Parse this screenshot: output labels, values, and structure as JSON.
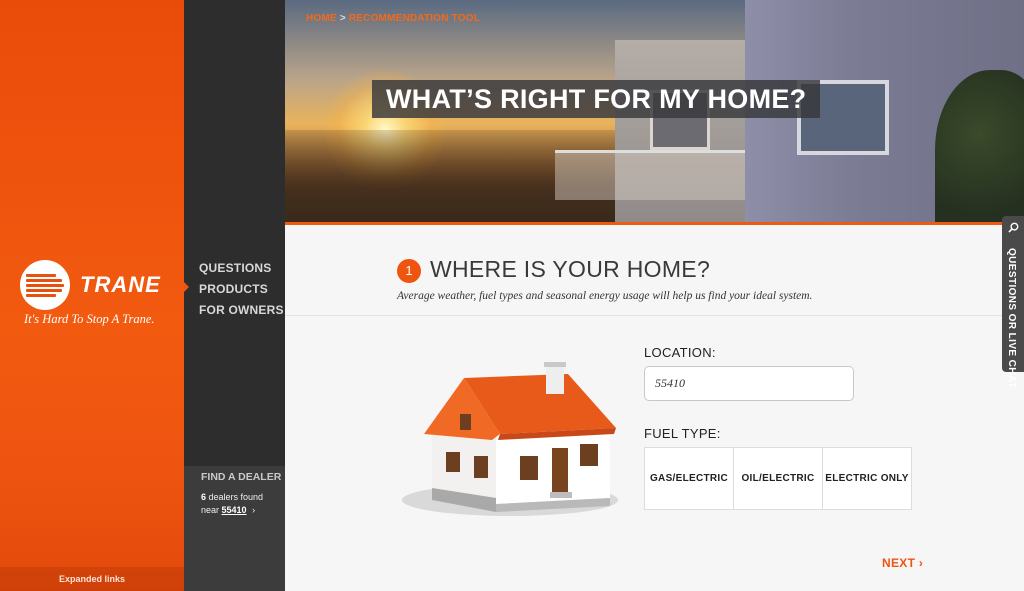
{
  "brand": {
    "logo_text": "TRANE",
    "tagline": "It's Hard To Stop A Trane.",
    "expanded_links": "Expanded links",
    "accent": "#ef5410"
  },
  "nav": {
    "items": [
      "QUESTIONS",
      "PRODUCTS",
      "FOR OWNERS"
    ],
    "dealer": {
      "title": "FIND A DEALER",
      "count": "6",
      "count_suffix": " dealers found",
      "near": "near ",
      "zip": "55410",
      "arrow": "›"
    }
  },
  "breadcrumb": {
    "home": "HOME",
    "separator": ">",
    "current": "RECOMMENDATION TOOL"
  },
  "hero": {
    "title": "WHAT’S RIGHT FOR MY HOME?"
  },
  "step": {
    "number": "1",
    "title": "WHERE IS YOUR HOME?",
    "subtitle": "Average weather, fuel types and seasonal energy usage will help us find your ideal system."
  },
  "form": {
    "location_label": "LOCATION:",
    "location_value": "55410",
    "fuel_label": "FUEL TYPE:",
    "fuel_options": [
      "GAS/ELECTRIC",
      "OIL/ELECTRIC",
      "ELECTRIC ONLY"
    ],
    "next_label": "NEXT ›"
  },
  "side_tab": {
    "label": "QUESTIONS OR LIVE CHAT",
    "icon": "search-icon"
  }
}
